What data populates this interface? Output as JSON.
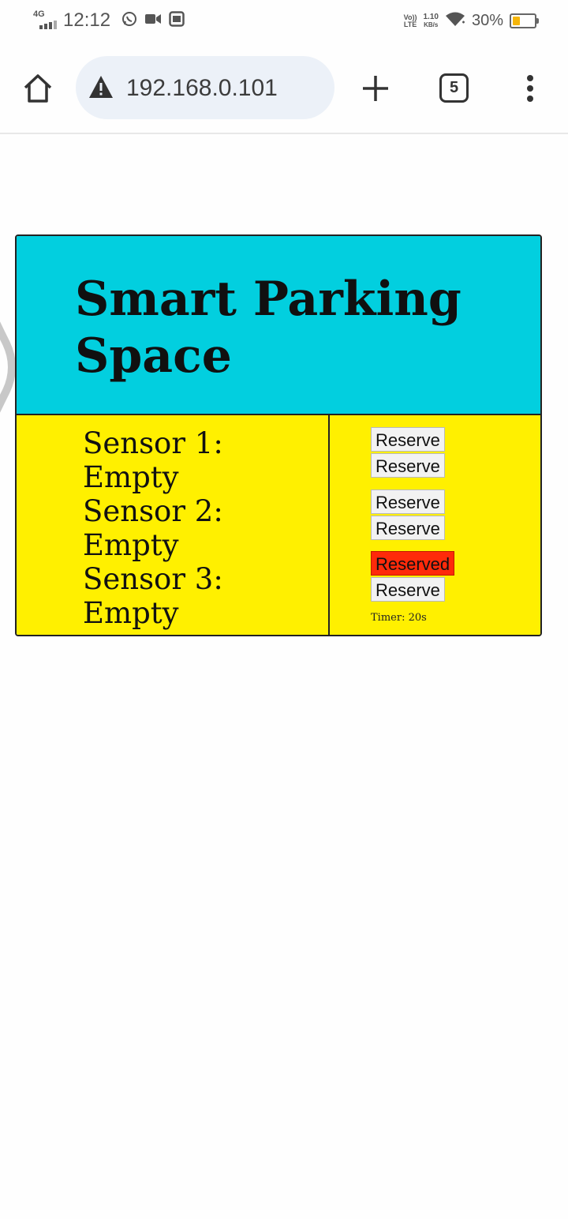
{
  "status_bar": {
    "network": "4G",
    "time": "12:12",
    "volte": "Vo)) LTE",
    "volte_line1": "Vo))",
    "volte_line2": "LTE",
    "speed_value": "1.10",
    "speed_unit": "KB/s",
    "battery_percent": "30%",
    "battery_level": 0.3,
    "battery_color": "#f5b50a",
    "icons": [
      "whatsapp-icon",
      "video-icon",
      "gallery-icon",
      "wifi-icon"
    ]
  },
  "browser": {
    "url": "192.168.0.101",
    "tab_count": "5",
    "icons": [
      "home-icon",
      "warning-icon",
      "plus-icon",
      "tabs-icon",
      "more-vert-icon"
    ]
  },
  "page": {
    "title": "Smart Parking Space",
    "header_color": "#02cfdf",
    "panel_color": "#fff000",
    "sensors": [
      {
        "label": "Sensor 1:",
        "status": "Empty"
      },
      {
        "label": "Sensor 2:",
        "status": "Empty"
      },
      {
        "label": "Sensor 3:",
        "status": "Empty"
      }
    ],
    "buttons": [
      {
        "label": "Reserve",
        "state": "available"
      },
      {
        "label": "Reserve",
        "state": "available"
      },
      {
        "label": "Reserve",
        "state": "available"
      },
      {
        "label": "Reserve",
        "state": "available"
      },
      {
        "label": "Reserved",
        "state": "reserved",
        "color": "#ff2a0a"
      },
      {
        "label": "Reserve",
        "state": "available"
      }
    ],
    "timer": "Timer: 20s"
  }
}
